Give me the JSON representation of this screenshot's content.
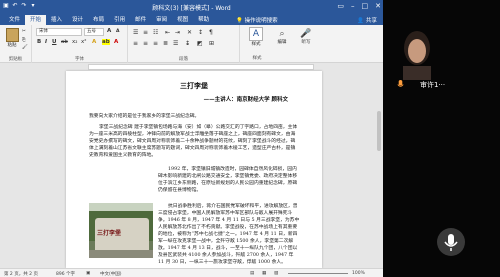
{
  "window": {
    "title": "顾科文(3) [兼容模式] - Word",
    "user": "微博"
  },
  "tabs": [
    "文件",
    "开始",
    "插入",
    "设计",
    "布局",
    "引用",
    "邮件",
    "审阅",
    "视图",
    "帮助"
  ],
  "active_tab": "开始",
  "tell_me": "操作说明搜索",
  "share": "共享",
  "ribbon": {
    "clipboard": {
      "paste": "粘贴",
      "label": "剪贴板"
    },
    "font": {
      "name": "宋体",
      "size": "五号",
      "label": "字体"
    },
    "paragraph": {
      "label": "段落"
    },
    "styles": {
      "button": "样式",
      "label": "样式"
    },
    "editing": {
      "button": "编辑"
    },
    "voice": {
      "button": "听写",
      "label": "语音"
    }
  },
  "document": {
    "heading": "三打李堡",
    "speaker": "——主讲人：南京财经大学 顾科文",
    "paragraphs": [
      "我要向大家介绍的是位于我家乡的李堡三战纪念碑。",
      "李堡三战纪念碑 建于李堡镇包场路与海（安）如（皋）公路交汇的丁字路口，占地四亩，主体为一座三米高的四棱柱型，冲锋向前的解放军战士浮雕坐落于碑座之上，碑座四面刻有碑文，由海安党史办撰写的碑文，碑文四周对称装饰着二十余种战争题材的花纹，碑刻了李堡战斗的经过，碑体上满刻着山江苏省文联主席苏题写的题词，碑文四周对称装饰着木棱工艺，造型庄严古朴，是镇史教育和爱国主义教育的阵地。",
      "1992 年，李堡镇旧城镇改造时，园碑体自然风化碎损，园内碑木影响新建的北闸公路交通安全，李堡镇党委、政府决定整体移位于滨江乡东侧路，在原址新规划的人民公园内重建纪念碑，原碑仍保留在县博物馆。",
      "抗日战争胜利后，蒋介石国民党军破坏和平，进攻解放区，曾三度侵占李堡，中国人民解放军苏中军区部队与敌人展开殊死斗争。1946 年 8 月，1947 年 4 月 11 日与 5 月三战李堡，为苏中人民解放苏北作出了不朽贡献。李堡战役，在苏中战场上有其重要的地位，被称为“苏中七战七捷”之一。1947 年 4 月 11 日，新四军一纵在攻克李堡一战中，全歼守敌 1500 余人，李堡第二次解放。1947 年 4 月 13 日，战斗，一至十一纵队九个团，八个团以及县区武装共 4100 余人参加战斗，歼敌 2700 余人，1947 年 11 月 30 日，一纵三十一旅攻李堡守敌，俘敌 1000 余人。"
    ],
    "photo_caption": "三打李堡"
  },
  "status": {
    "page": "第 2 页，共 2 页",
    "words": "896 个字",
    "lang": "中文(中国)",
    "zoom": "100%"
  },
  "webcam": {
    "name": "审许1···"
  }
}
